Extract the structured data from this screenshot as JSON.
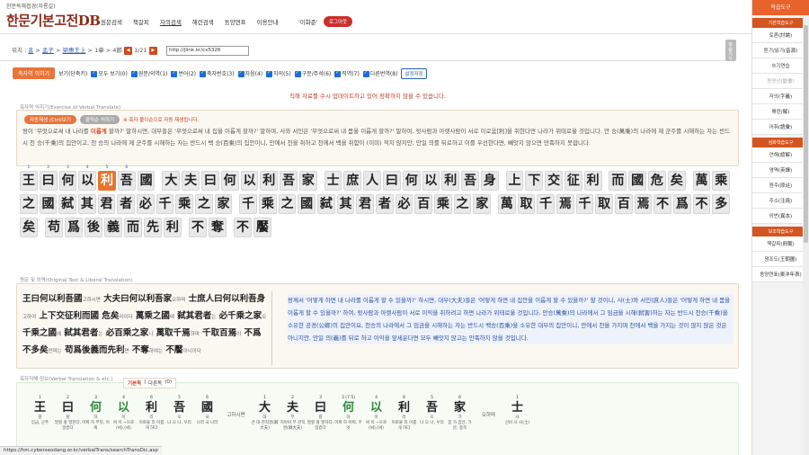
{
  "header": {
    "sub_title": "한문독해첩경(자룡길)",
    "site_title": "한문기본고전DB",
    "nav": [
      "원문검색",
      "책갈피",
      "자의검색",
      "해런검색",
      "동양연표",
      "이용안내"
    ],
    "user": "'이화준'",
    "logout_label": "로그아웃"
  },
  "crumb": {
    "location_label": "위치 :",
    "home": "홈",
    "book": "孟子",
    "chapter": "梁惠王上",
    "part": "1章",
    "para": "4節",
    "page": "1/21",
    "url": "http://jlink.kr/cx5326",
    "side_label": "학습기사"
  },
  "options": {
    "btn_label": "축자역 익히기",
    "view_label": "보기(단축키)",
    "items": [
      "모두 보기(0)",
      "원문/의역(1)",
      "번어(2)",
      "축자번호(3)",
      "자음(4)",
      "자의(5)",
      "구문/주석(6)",
      "직역(7)",
      "다른번역(8)"
    ],
    "settings_label": "설정저장"
  },
  "notice": "직해 자료를 수시 업데이트하고 있어 정확하지 않을 수 있습니다.",
  "panel1": {
    "title": "축자역 익히기(Exercise of Verbal Translate)",
    "tab_on": "자동재생 (Ctrl/보기",
    "tab_off": "클릭순 익히기",
    "note": "※ 축자 풀이순으로 자동 재생됩니다.",
    "text_before": "왕이 '무엇으로써 내 나라를",
    "text_hl": "이롭게",
    "text_after": "할까?' 말하시면, 대부들은 '무엇으로써 내 집을 이롭게 할까?' 말하며, 사와 서인은 '무엇으로써 내 몸을 이롭게 할까?' 말하여, 윗사람과 아랫사람이 서로 이로움[利]을 취한다면 나라가 위태로울 것입니다. 만 승(萬乘)의 나라에 제 군주를 시해하는 자는 반드시 천 승(千乘)의 집안이고, 천 승의 나라에 제 군주를 시해하는 자는 반드시 백 승(百乘)의 집안이니, 만에서 천을 취하고 천에서 백을 취함이 (이미) 적지 않지만, 만일 의를 뒤로하고 이를 우선한다면, 빼앗지 않으면 만족하지 못합니다."
  },
  "char_rows": [
    [
      "王",
      "曰",
      "何",
      "以",
      "利",
      "吾",
      "國",
      "|",
      "大",
      "夫",
      "曰",
      "何",
      "以",
      "利",
      "吾",
      "家",
      "|",
      "士",
      "庶",
      "人",
      "曰",
      "何",
      "以",
      "利",
      "吾",
      "身",
      "|",
      "上",
      "下",
      "交",
      "征",
      "利",
      "|",
      "而",
      "國",
      "危",
      "矣",
      "|",
      "萬",
      "乘"
    ],
    [
      "之",
      "國",
      "弑",
      "其",
      "君",
      "者",
      "必",
      "千",
      "乘",
      "之",
      "家",
      "|",
      "千",
      "乘",
      "之",
      "國",
      "弑",
      "其",
      "君",
      "者",
      "必",
      "百",
      "乘",
      "之",
      "家",
      "|",
      "萬",
      "取",
      "千",
      "焉",
      "千",
      "取",
      "百",
      "焉",
      "不",
      "爲",
      "不",
      "多"
    ],
    [
      "矣",
      "|",
      "苟",
      "爲",
      "後",
      "義",
      "而",
      "先",
      "利",
      "|",
      "不",
      "奪",
      "|",
      "不",
      "饜"
    ]
  ],
  "char_nums": [
    "1",
    "2",
    "3",
    "4",
    "5",
    "6"
  ],
  "panel2": {
    "title": "원문 및 의역(Original Text & Liberal Translation)",
    "original": [
      {
        "t": "王曰何以利吾國",
        "g": "고하시면"
      },
      {
        "t": "大夫曰何以利吾家",
        "g": "오하며"
      },
      {
        "t": "士庶人曰何以利吾身",
        "g": "고하여"
      },
      {
        "t": "上下交征利而國",
        "g": ""
      },
      {
        "t": "危矣",
        "g": "리이다"
      },
      {
        "t": "萬乘之國",
        "g": "에"
      },
      {
        "t": "弑其君者",
        "g": "는"
      },
      {
        "t": "必千乘之家",
        "g": "오"
      },
      {
        "t": "千乘之國",
        "g": "에"
      },
      {
        "t": "弑其君者",
        "g": "는"
      },
      {
        "t": "必百乘之家",
        "g": "니"
      },
      {
        "t": "萬取千焉",
        "g": "하며"
      },
      {
        "t": "千取百焉",
        "g": "이"
      },
      {
        "t": "不爲不多矣",
        "g": "언마는"
      },
      {
        "t": "苟爲後義而先利",
        "g": "면"
      },
      {
        "t": "不奪",
        "g": "하여는"
      },
      {
        "t": "不饜",
        "g": "이니이다"
      }
    ],
    "translation": "왕께서 '어떻게 하면 내 나라를 이롭게 할 수 있을까?' 하시면, 대부(大夫)들은 '어떻게 하면 내 집안을 이롭게 할 수 있을까?' 할 것이니, 사(士)와 서인(庶人)들은 '어떻게 하면 내 몸을 이롭게 할 수 있을까?' 하여, 윗사람과 아랫사람이 서로 이익을 취하려고 하면 나라가 위태로울 것입니다. 만승(萬乘)의 나라에서 그 임금을 시해(弑害)하는 자는 반드시 천승(千乘)을 소유한 공경(公卿)의 집안이요, 천승의 나라에서 그 임금을 시해하는 자는 반드시 백승(百乘)을 소유한 대부의 집안이니, 만에서 천을 가지며 천에서 백을 가지는 것이 많지 않은 것은 아니지만, 만일 의(義)를 뒤로 하고 이익을 앞세운다면 모두 빼앗지 않고는 만족하지 않을 것입니다."
  },
  "panel3": {
    "title": "축자직해 정보(Verbal Translation & etc.)",
    "tab_basic": "기본독",
    "tab_other": "다른독",
    "tab_count": "(0)",
    "gloss": [
      {
        "n": "1",
        "c": "王",
        "g": false,
        "s": "왕",
        "d": "임금, 군주"
      },
      {
        "n": "2",
        "c": "曰",
        "g": false,
        "s": "왈",
        "d": "말할 왈 말한다, 일컫다"
      },
      {
        "n": "3",
        "c": "何",
        "g": true,
        "s": "하",
        "d": "어찌 하 무엇, 어찌"
      },
      {
        "n": "4",
        "c": "以",
        "g": true,
        "s": "이",
        "d": "써 이 ~으로(써),(써)"
      },
      {
        "n": "6",
        "c": "利",
        "g": false,
        "s": "리",
        "d": "이로울 리 이롭게 하다"
      },
      {
        "n": "5",
        "c": "吾",
        "g": false,
        "s": "오",
        "d": "나 오 나, 우리"
      },
      {
        "n": "6",
        "c": "國",
        "g": false,
        "s": "국",
        "d": "나라 국 나라"
      },
      {
        "m": "고하시면"
      },
      {
        "n": "1",
        "c": "大",
        "g": false,
        "s": "대",
        "d": "큰 대 관직명(卿大夫)"
      },
      {
        "n": "2",
        "c": "夫",
        "g": false,
        "s": "부",
        "d": "지아비 부 관직명(卿大夫)"
      },
      {
        "n": "3",
        "c": "曰",
        "g": false,
        "s": "왈",
        "d": "말할 왈 말하다, 일컫다"
      },
      {
        "n": "3 (7.5)",
        "c": "何",
        "g": true,
        "s": "하",
        "d": "어찌 하 어찌, 무엇"
      },
      {
        "n": "4",
        "c": "以",
        "g": true,
        "s": "이",
        "d": "써 이 ~으로(써),(써)"
      },
      {
        "n": "6",
        "c": "利",
        "g": false,
        "s": "리",
        "d": "이로울 리 이롭게 하다"
      },
      {
        "n": "5",
        "c": "吾",
        "g": false,
        "s": "오",
        "d": "나 오 나, 우리"
      },
      {
        "n": "6",
        "c": "家",
        "g": false,
        "s": "가",
        "d": "집 가 집안, 가문, 종족"
      },
      {
        "m": "오하며"
      },
      {
        "n": "1",
        "c": "士",
        "g": false,
        "s": "사",
        "d": "선비 사 사(士)"
      }
    ]
  },
  "sidebar": {
    "top_label": "학습도구",
    "sec1": "기본학습도구",
    "items1": [
      "토론(討論)",
      "듣기/읽기(音源)",
      "쓰기연습",
      "동영상(動畫)",
      "자의(字義)",
      "해런(解)",
      "어휘(語彙)"
    ],
    "dim_items": [
      "동영상(動畫)"
    ],
    "sec2": "심화학습도구",
    "items2": [
      "언해(諺解)",
      "영역(英譯)",
      "원주(原註)",
      "주소(注疏)",
      "외번(異本)"
    ],
    "sec3": "보조학습도구",
    "items3": [
      "책갈피(冊籤)",
      "왕조도(王朝圖)",
      "동양연표(東洋年表)"
    ]
  },
  "status": "https://hm.cyberseodang.or.kr/verbalTrans/searchTransDic.asp"
}
